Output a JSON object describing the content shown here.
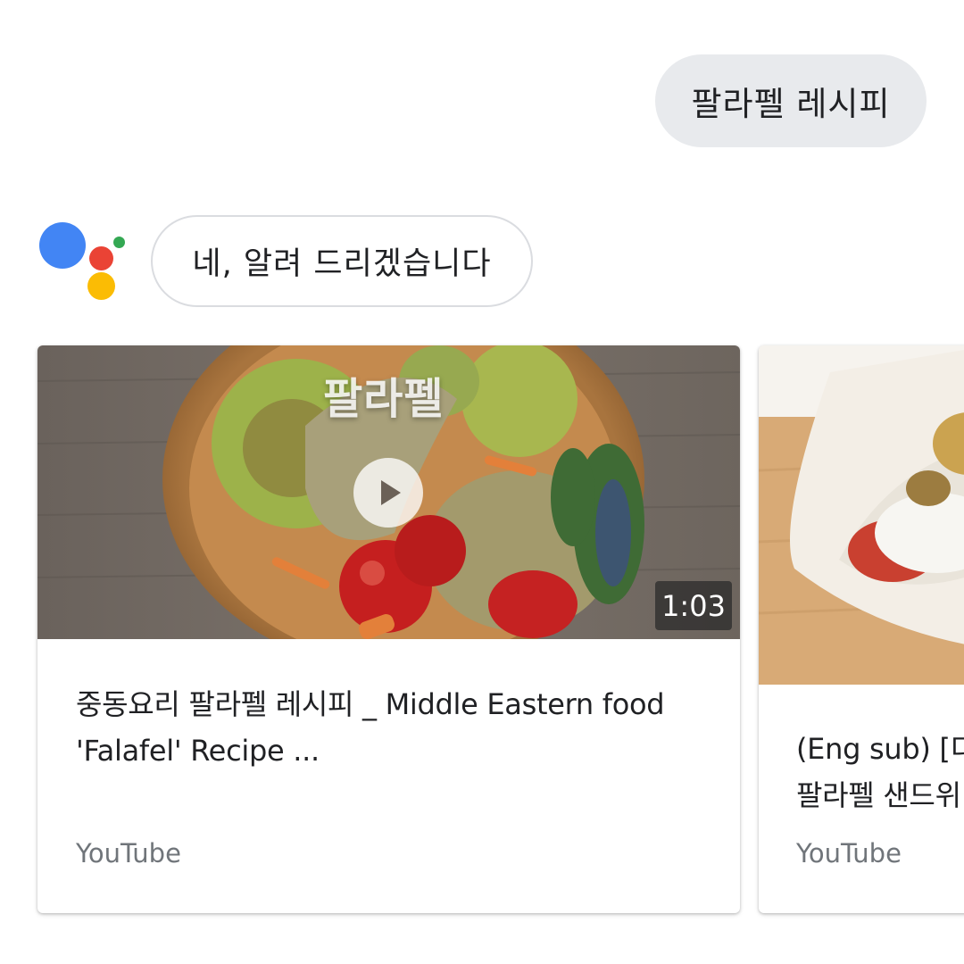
{
  "user_query": {
    "text": "팔라펠 레시피"
  },
  "assistant": {
    "reply": "네, 알려 드리겠습니다",
    "logo_colors": {
      "blue": "#4285f4",
      "red": "#ea4335",
      "yellow": "#fbbc04",
      "green": "#34a853"
    }
  },
  "results": [
    {
      "thumbnail_overlay": "팔라펠",
      "duration": "1:03",
      "title": "중동요리 팔라펠 레시피 _ Middle Eastern food 'Falafel' Recipe ...",
      "source": "YouTube",
      "play_icon": "play-icon"
    },
    {
      "title_line_1": "(Eng sub) [디",
      "title_line_2": "팔라펠 샌드위",
      "source": "YouTube"
    }
  ]
}
